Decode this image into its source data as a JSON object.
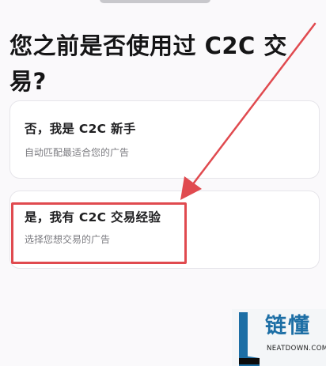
{
  "title": "您之前是否使用过 C2C 交易?",
  "options": [
    {
      "title": "否，我是 C2C 新手",
      "subtitle": "自动匹配最适合您的广告"
    },
    {
      "title": "是，我有 C2C 交易经验",
      "subtitle": "选择您想交易的广告"
    }
  ],
  "watermark": {
    "brand": "链懂",
    "domain": "NEATDOWN.COM"
  },
  "colors": {
    "highlight": "#e04a4f",
    "brand": "#1c6ea5"
  }
}
